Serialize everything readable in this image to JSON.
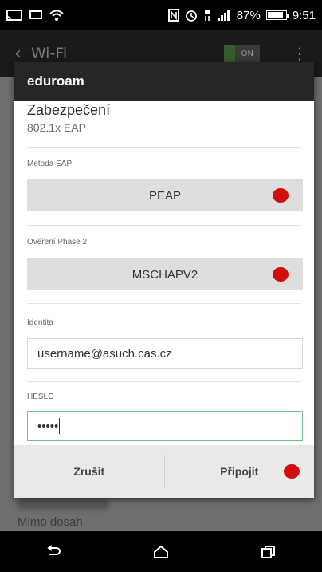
{
  "status": {
    "battery": "87%",
    "time": "9:51"
  },
  "actionbar": {
    "back_icon": "back-chevron-icon",
    "title": "Wi-Fi",
    "toggle_label": "ON",
    "overflow_icon": "overflow-menu-icon"
  },
  "background": {
    "network_status": "Mimo dosah"
  },
  "dialog": {
    "title": "eduroam",
    "security_label": "Zabezpečení",
    "security_value": "802.1x EAP",
    "eap_label": "Metoda EAP",
    "eap_value": "PEAP",
    "phase2_label": "Ověření Phase 2",
    "phase2_value": "MSCHAPV2",
    "identity_label": "Identita",
    "identity_value": "username@asuch.cas.cz",
    "password_label": "HESLO",
    "password_value": "•••••",
    "cancel_label": "Zrušit",
    "connect_label": "Připojit"
  },
  "colors": {
    "marker_red": "#d10e0e",
    "focus_green": "#6ec28a"
  }
}
